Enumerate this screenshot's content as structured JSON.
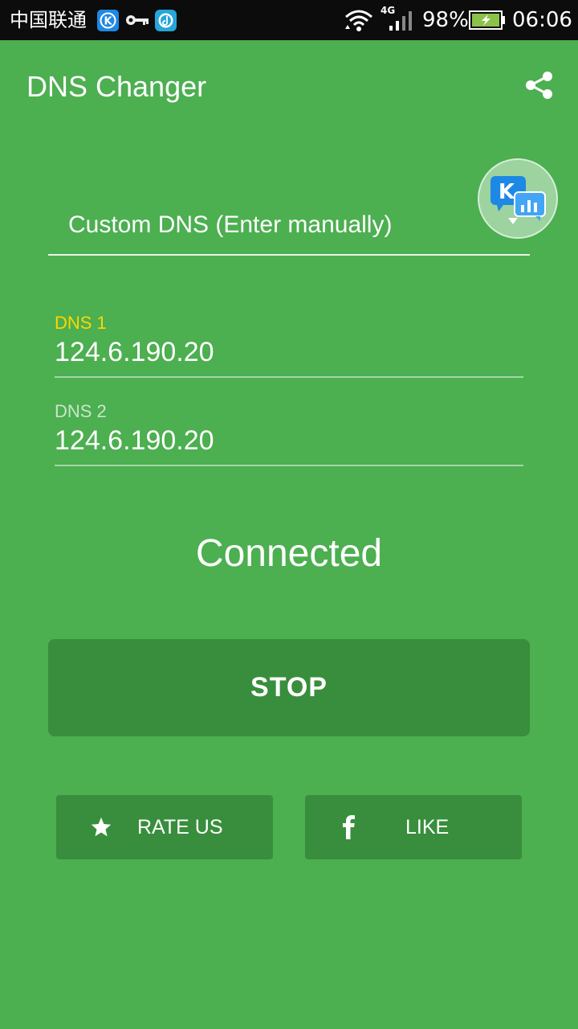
{
  "status_bar": {
    "carrier": "中国联通",
    "network_type": "4G",
    "battery_percent": "98%",
    "time": "06:06",
    "icons": [
      "kugou-icon",
      "key-icon",
      "music-icon",
      "wifi-icon",
      "signal-icon",
      "battery-icon"
    ]
  },
  "toolbar": {
    "title": "DNS Changer",
    "share_icon": "share-icon"
  },
  "floating_badge": {
    "icon": "k-chat-stats-icon",
    "letter": "K"
  },
  "dns_spinner": {
    "selected": "Custom DNS (Enter manually)"
  },
  "dns1": {
    "label": "DNS 1",
    "value": "124.6.190.20"
  },
  "dns2": {
    "label": "DNS 2",
    "value": "124.6.190.20"
  },
  "connection_status": "Connected",
  "stop_button": {
    "label": "STOP"
  },
  "rate_button": {
    "label": "RATE US",
    "icon": "star-icon"
  },
  "like_button": {
    "label": "LIKE",
    "icon": "facebook-icon"
  },
  "colors": {
    "background": "#4caf50",
    "button": "#388e3c",
    "active_label": "#ffd600"
  }
}
